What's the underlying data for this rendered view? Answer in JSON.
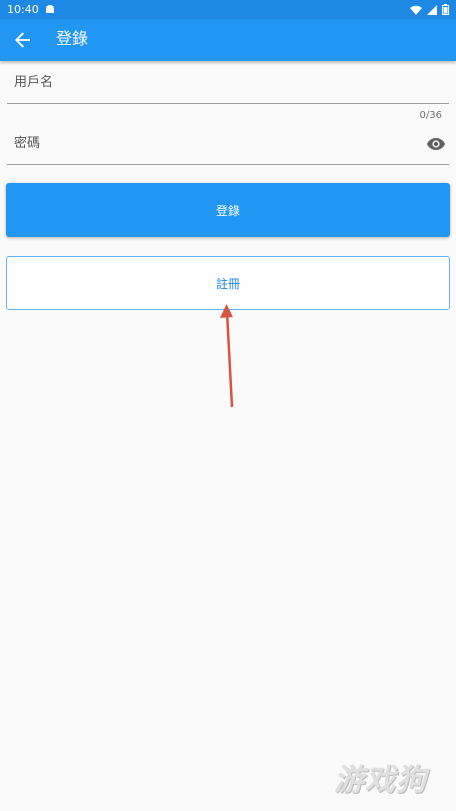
{
  "status_bar": {
    "time": "10:40"
  },
  "app_bar": {
    "title": "登錄"
  },
  "form": {
    "username_placeholder": "用戶名",
    "password_placeholder": "密碼",
    "password_counter": "0/36"
  },
  "buttons": {
    "login_label": "登錄",
    "register_label": "註冊"
  },
  "watermark": "游戏狗",
  "colors": {
    "primary": "#2196f3",
    "status_bar": "#1e88e5",
    "annotation_arrow": "#d9543f"
  }
}
